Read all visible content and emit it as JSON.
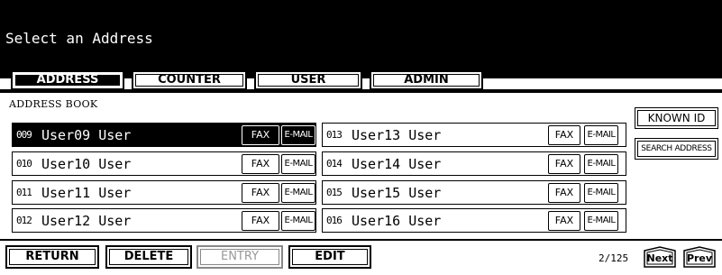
{
  "header": {
    "title": "Select an Address"
  },
  "tabs": [
    {
      "label": "ADDRESS",
      "active": true
    },
    {
      "label": "COUNTER",
      "active": false
    },
    {
      "label": "USER",
      "active": false
    },
    {
      "label": "ADMIN",
      "active": false
    }
  ],
  "section": {
    "label": "ADDRESS BOOK"
  },
  "entries": [
    {
      "num": "009",
      "name": "User09 User",
      "fax": "FAX",
      "email": "E-MAIL",
      "selected": true
    },
    {
      "num": "010",
      "name": "User10 User",
      "fax": "FAX",
      "email": "E-MAIL"
    },
    {
      "num": "011",
      "name": "User11 User",
      "fax": "FAX",
      "email": "E-MAIL"
    },
    {
      "num": "012",
      "name": "User12 User",
      "fax": "FAX",
      "email": "E-MAIL"
    },
    {
      "num": "013",
      "name": "User13 User",
      "fax": "FAX",
      "email": "E-MAIL"
    },
    {
      "num": "014",
      "name": "User14 User",
      "fax": "FAX",
      "email": "E-MAIL"
    },
    {
      "num": "015",
      "name": "User15 User",
      "fax": "FAX",
      "email": "E-MAIL"
    },
    {
      "num": "016",
      "name": "User16 User",
      "fax": "FAX",
      "email": "E-MAIL"
    }
  ],
  "side": {
    "known_id": "KNOWN ID",
    "search_address": "SEARCH ADDRESS"
  },
  "footer": {
    "return_label": "RETURN",
    "delete_label": "DELETE",
    "entry_label": "ENTRY",
    "edit_label": "EDIT",
    "page_indicator": "2/125",
    "next_label": "Next",
    "prev_label": "Prev"
  }
}
